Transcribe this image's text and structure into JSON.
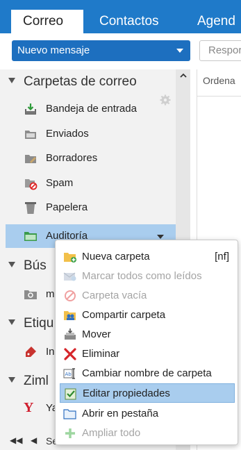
{
  "tabs": [
    {
      "label": "Correo"
    },
    {
      "label": "Contactos"
    },
    {
      "label": "Agend"
    }
  ],
  "toolbar": {
    "new_message": "Nuevo mensaje",
    "reply": "Respor"
  },
  "right_pane": {
    "sort_label": "Ordena"
  },
  "sidebar": {
    "mail_folders_header": "Carpetas de correo",
    "folders": [
      {
        "label": "Bandeja de entrada",
        "icon": "inbox-icon"
      },
      {
        "label": "Enviados",
        "icon": "sent-folder-icon"
      },
      {
        "label": "Borradores",
        "icon": "drafts-folder-icon"
      },
      {
        "label": "Spam",
        "icon": "spam-folder-icon"
      },
      {
        "label": "Papelera",
        "icon": "trash-icon"
      },
      {
        "label": "Auditoría",
        "icon": "folder-icon"
      }
    ],
    "searches_header": "Bús",
    "searches_item": "m",
    "tags_header": "Etiqu",
    "tags_item": "In",
    "zimlets_header": "Ziml",
    "zimlets_item": "Ya",
    "bottom_text": "Se"
  },
  "context_menu": {
    "items": [
      {
        "label": "Nueva carpeta",
        "shortcut": "[nf]",
        "enabled": true
      },
      {
        "label": "Marcar todos como leídos",
        "shortcut": "",
        "enabled": false
      },
      {
        "label": "Carpeta vacía",
        "shortcut": "",
        "enabled": false
      },
      {
        "label": "Compartir carpeta",
        "shortcut": "",
        "enabled": true
      },
      {
        "label": "Mover",
        "shortcut": "",
        "enabled": true
      },
      {
        "label": "Eliminar",
        "shortcut": "",
        "enabled": true
      },
      {
        "label": "Cambiar nombre de carpeta",
        "shortcut": "",
        "enabled": true
      },
      {
        "label": "Editar propiedades",
        "shortcut": "",
        "enabled": true
      },
      {
        "label": "Abrir en pestaña",
        "shortcut": "",
        "enabled": true
      },
      {
        "label": "Ampliar todo",
        "shortcut": "",
        "enabled": false
      }
    ]
  },
  "colors": {
    "topbar": "#1f7ac9",
    "primary_button": "#1d6fbf",
    "selection": "#a9cdee"
  }
}
